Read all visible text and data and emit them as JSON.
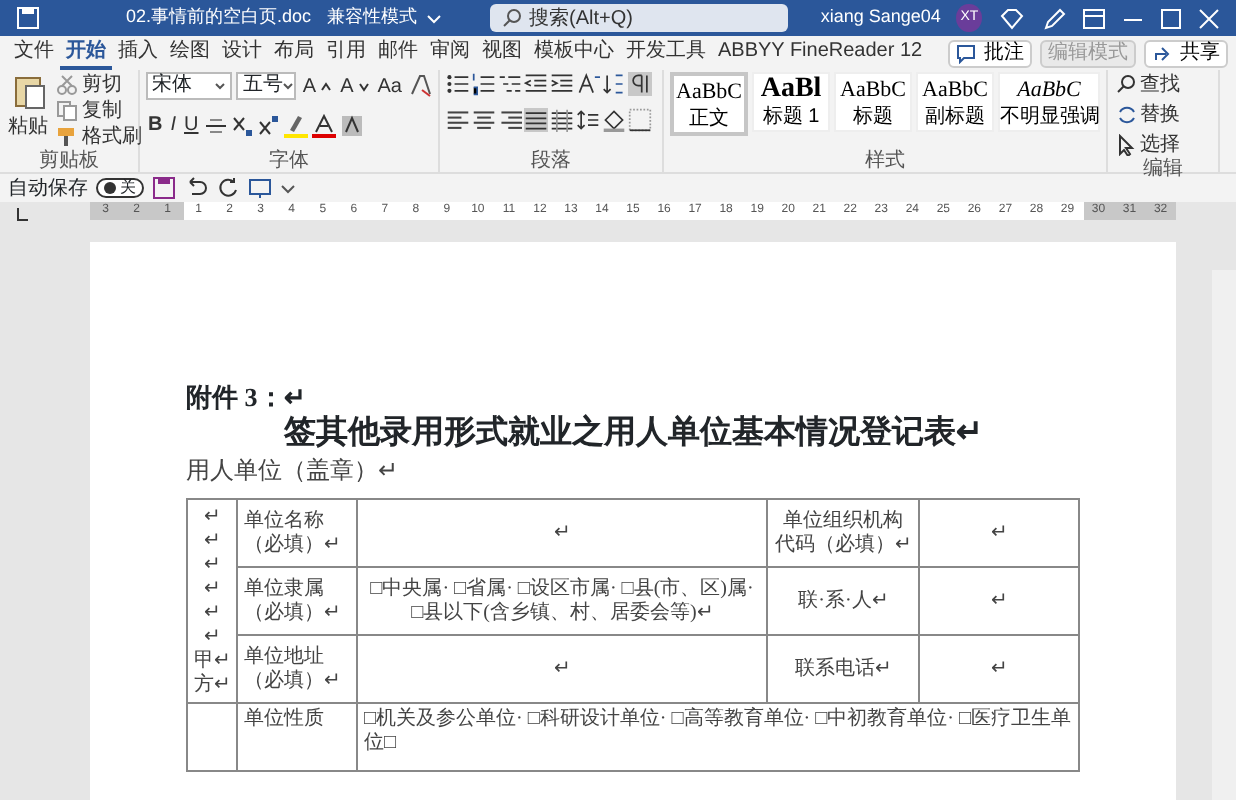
{
  "title_bar": {
    "document_name": "02.事情前的空白页.doc",
    "mode": "兼容性模式",
    "search_placeholder": "搜索(Alt+Q)",
    "user_name": "xiang Sange04",
    "avatar_initials": "XT"
  },
  "ribbon_tabs": [
    {
      "label": "文件",
      "selected": false
    },
    {
      "label": "开始",
      "selected": true
    },
    {
      "label": "插入",
      "selected": false
    },
    {
      "label": "绘图",
      "selected": false
    },
    {
      "label": "设计",
      "selected": false
    },
    {
      "label": "布局",
      "selected": false
    },
    {
      "label": "引用",
      "selected": false
    },
    {
      "label": "邮件",
      "selected": false
    },
    {
      "label": "审阅",
      "selected": false
    },
    {
      "label": "视图",
      "selected": false
    },
    {
      "label": "模板中心",
      "selected": false
    },
    {
      "label": "开发工具",
      "selected": false
    },
    {
      "label": "ABBYY FineReader 12",
      "selected": false
    }
  ],
  "ribbon_actions": {
    "comment": "批注",
    "editing": "编辑模式",
    "share": "共享"
  },
  "ribbon": {
    "clipboard": {
      "label": "剪贴板",
      "paste": "粘贴",
      "cut": "剪切",
      "copy": "复制",
      "format_painter": "格式刷"
    },
    "font": {
      "label": "字体",
      "font_name": "宋体",
      "font_size": "五号",
      "grow_font": "A",
      "shrink_font": "A",
      "change_case": "Aa",
      "bold": "B",
      "italic": "I",
      "underline": "U"
    },
    "paragraph": {
      "label": "段落"
    },
    "styles": {
      "label": "样式",
      "items": [
        {
          "preview": "AaBbC",
          "name": "正文",
          "selected": true
        },
        {
          "preview": "AaBl",
          "name": "标题 1",
          "selected": false
        },
        {
          "preview": "AaBbC",
          "name": "标题",
          "selected": false
        },
        {
          "preview": "AaBbC",
          "name": "副标题",
          "selected": false
        },
        {
          "preview": "AaBbC",
          "name": "不明显强调",
          "selected": false
        }
      ]
    },
    "editing": {
      "label": "编辑",
      "find": "查找",
      "replace": "替换",
      "select": "选择"
    }
  },
  "quick_access": {
    "autosave_label": "自动保存",
    "autosave_on": false,
    "toggle_text": "关"
  },
  "ruler": {
    "left_numbers": [
      "3",
      "2",
      "1"
    ],
    "numbers": [
      "1",
      "2",
      "3",
      "4",
      "5",
      "6",
      "7",
      "8",
      "9",
      "10",
      "11",
      "12",
      "13",
      "14",
      "15",
      "16",
      "17",
      "18",
      "19",
      "20",
      "21",
      "22",
      "23",
      "24",
      "25",
      "26",
      "27",
      "28",
      "29"
    ],
    "right_numbers": [
      "30",
      "31",
      "32"
    ]
  },
  "document": {
    "attachment_heading": "附件 3：↵",
    "title": "签其他录用形式就业之用人单位基本情况登记表↵",
    "unit_line": "用人单位（盖章）↵",
    "table": {
      "side_lines": [
        "↵",
        "↵",
        "↵",
        "↵",
        "↵",
        "↵",
        "甲↵",
        "方↵"
      ],
      "rows": [
        {
          "kind": "pair",
          "label": "单位名称（必填）↵",
          "value": "↵",
          "label_2": "单位组织机构代码（必填）↵",
          "value_2": "↵"
        },
        {
          "kind": "pair",
          "label": "单位隶属（必填）↵",
          "value": "□中央属· □省属· □设区市属· □县(市、区)属· □县以下(含乡镇、村、居委会等)↵",
          "label_2": "联·系·人↵",
          "value_2": "↵"
        },
        {
          "kind": "pair",
          "label": "单位地址（必填）↵",
          "value": "↵",
          "label_2": "联系电话↵",
          "value_2": "↵"
        },
        {
          "kind": "wide",
          "label": "单位性质",
          "value": "□机关及参公单位· □科研设计单位· □高等教育单位· □中初教育单位· □医疗卫生单位□"
        }
      ]
    }
  }
}
